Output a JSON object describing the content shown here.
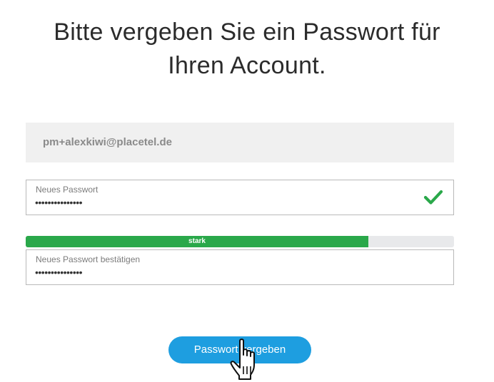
{
  "heading": {
    "line1": "Bitte vergeben Sie ein Passwort für",
    "line2": "Ihren Account."
  },
  "email": {
    "value": "pm+alexkiwi@placetel.de"
  },
  "new_password": {
    "label": "Neues Passwort",
    "value": "•••••••••••••••",
    "valid_icon": "checkmark-icon"
  },
  "strength": {
    "label": "stark",
    "fraction": 0.8,
    "color": "#2aa84a"
  },
  "confirm_password": {
    "label": "Neues Passwort bestätigen",
    "value": "•••••••••••••••"
  },
  "submit": {
    "label": "Passwort vergeben",
    "color": "#1e9ee0"
  },
  "cursor": {
    "icon": "hand-pointer-cursor-icon"
  }
}
